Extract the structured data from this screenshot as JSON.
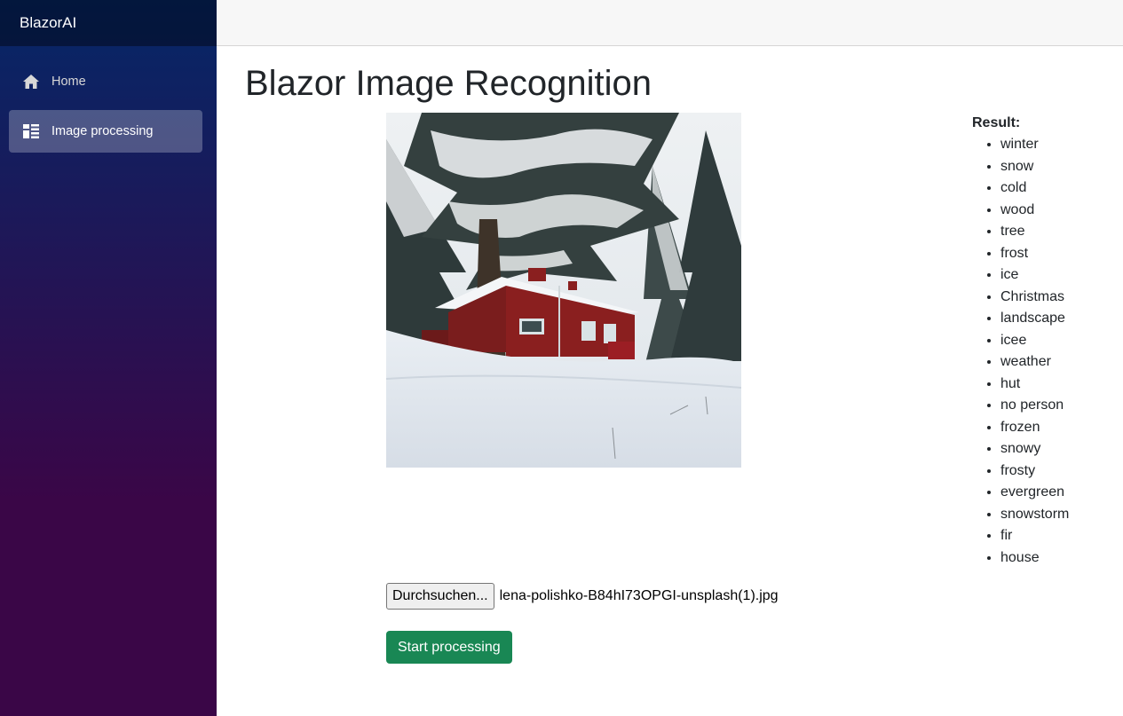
{
  "brand": "BlazorAI",
  "nav": {
    "items": [
      {
        "label": "Home",
        "icon": "home-icon",
        "active": false
      },
      {
        "label": "Image processing",
        "icon": "list-layout-icon",
        "active": true
      }
    ]
  },
  "main": {
    "title": "Blazor Image Recognition",
    "result": {
      "title": "Result:",
      "items": [
        "winter",
        "snow",
        "cold",
        "wood",
        "tree",
        "frost",
        "ice",
        "Christmas",
        "landscape",
        "icee",
        "weather",
        "hut",
        "no person",
        "frozen",
        "snowy",
        "frosty",
        "evergreen",
        "snowstorm",
        "fir",
        "house"
      ]
    },
    "file": {
      "browse_label": "Durchsuchen...",
      "file_name": "lena-polishko-B84hI73OPGI-unsplash(1).jpg"
    },
    "start_button": "Start processing"
  },
  "colors": {
    "sidebar_top": "#052767",
    "sidebar_bottom": "#3a0647",
    "start_button": "#198754"
  }
}
